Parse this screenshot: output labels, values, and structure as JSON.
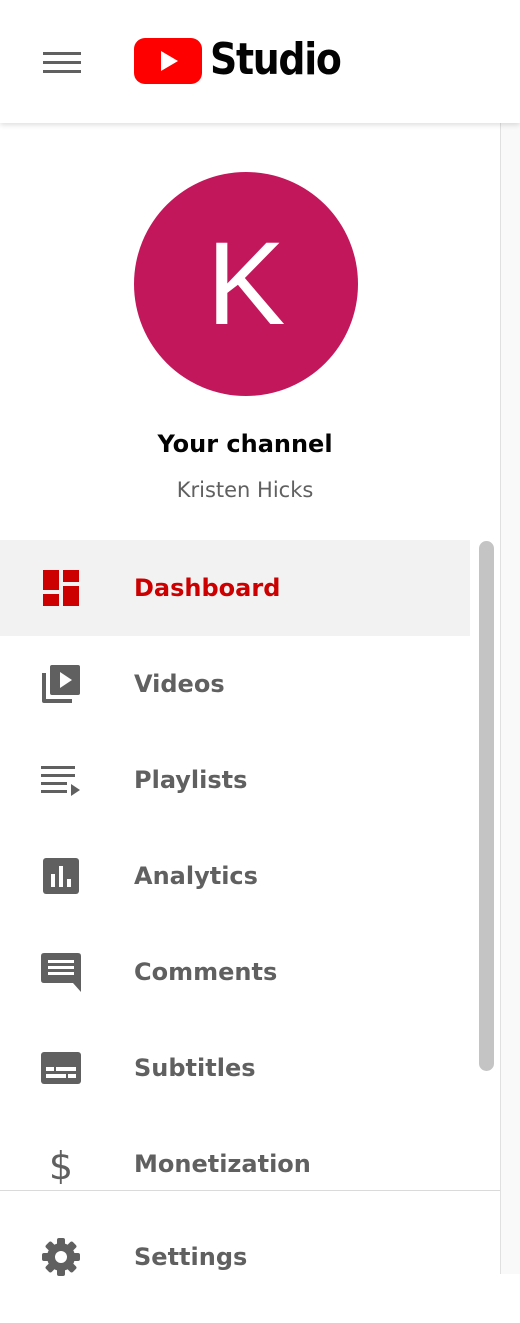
{
  "header": {
    "menu_icon": "hamburger-menu-icon",
    "logo_icon": "youtube-play-icon",
    "logo_text": "Studio",
    "brand_color": "#ff0000"
  },
  "channel": {
    "avatar_letter": "K",
    "avatar_color": "#c2185b",
    "title": "Your channel",
    "name": "Kristen Hicks"
  },
  "nav": {
    "items": [
      {
        "label": "Dashboard",
        "icon": "dashboard-icon",
        "active": true
      },
      {
        "label": "Videos",
        "icon": "video-library-icon",
        "active": false
      },
      {
        "label": "Playlists",
        "icon": "playlist-icon",
        "active": false
      },
      {
        "label": "Analytics",
        "icon": "analytics-icon",
        "active": false
      },
      {
        "label": "Comments",
        "icon": "comment-icon",
        "active": false
      },
      {
        "label": "Subtitles",
        "icon": "subtitles-icon",
        "active": false
      },
      {
        "label": "Monetization",
        "icon": "dollar-icon",
        "active": false
      }
    ],
    "active_color": "#cc0000",
    "text_color": "#606060"
  },
  "footer": {
    "settings_label": "Settings",
    "settings_icon": "gear-icon"
  }
}
